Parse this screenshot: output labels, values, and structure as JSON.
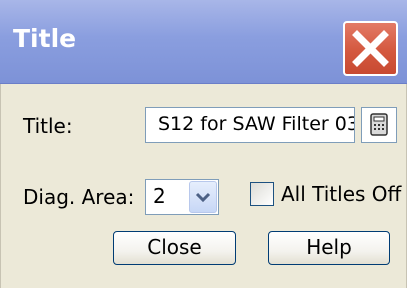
{
  "window": {
    "title": "Title"
  },
  "form": {
    "title_label": "Title:",
    "title_value": "S12 for SAW Filter 03",
    "diag_area_label": "Diag. Area:",
    "diag_area_value": "2",
    "all_titles_off_label": "All Titles Off",
    "all_titles_off_checked": false
  },
  "buttons": {
    "close_label": "Close",
    "help_label": "Help"
  },
  "icons": {
    "close": "close-icon",
    "calculator": "calculator-icon",
    "dropdown": "chevron-down-icon"
  }
}
